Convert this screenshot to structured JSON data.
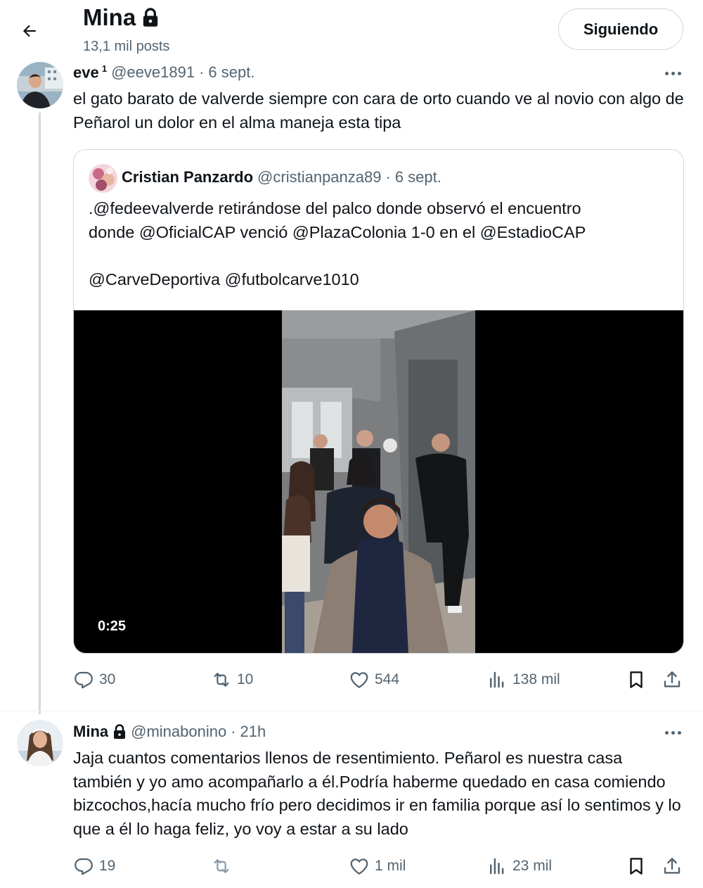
{
  "header": {
    "profile_name": "Mina",
    "posts_count": "13,1 mil posts",
    "follow_label": "Siguiendo"
  },
  "tweet1": {
    "name": "eve",
    "superscript": "1",
    "handle": "@eeve1891",
    "separator": "·",
    "time": "6 sept.",
    "text": "el gato barato de valverde siempre con cara de orto cuando ve al novio con algo de Peñarol un dolor en el alma maneja esta tipa",
    "quote": {
      "name": "Cristian Panzardo",
      "handle": "@cristianpanza89",
      "separator": "·",
      "time": "6 sept.",
      "line1": ".@fedeevalverde retirándose del palco donde observó el encuentro",
      "line2": "donde @OficialCAP venció @PlazaColonia 1-0 en el @EstadioCAP",
      "line3": "@CarveDeportiva @futbolcarve1010",
      "video_duration": "0:25"
    },
    "stats": {
      "replies": "30",
      "reposts": "10",
      "likes": "544",
      "views": "138 mil"
    }
  },
  "tweet2": {
    "name": "Mina",
    "handle": "@minabonino",
    "separator": "·",
    "time": "21h",
    "text": "Jaja cuantos comentarios llenos de resentimiento. Peñarol es nuestra casa también y yo amo acompañarlo a él.Podría haberme quedado en casa comiendo bizcochos,hacía mucho frío pero decidimos ir en familia porque así lo sentimos y lo que a él lo haga feliz, yo voy a estar a su lado",
    "stats": {
      "replies": "19",
      "reposts": "",
      "likes": "1 mil",
      "views": "23 mil"
    }
  },
  "icons": {
    "back": "arrow-left-icon",
    "lock": "lock-icon",
    "more": "more-dots-icon",
    "reply": "reply-bubble-icon",
    "repost": "repost-icon",
    "like": "heart-icon",
    "views": "views-bars-icon",
    "bookmark": "bookmark-icon",
    "share": "share-icon"
  },
  "colors": {
    "text_primary": "#0f1419",
    "text_secondary": "#536471",
    "border": "#cfd9de"
  }
}
